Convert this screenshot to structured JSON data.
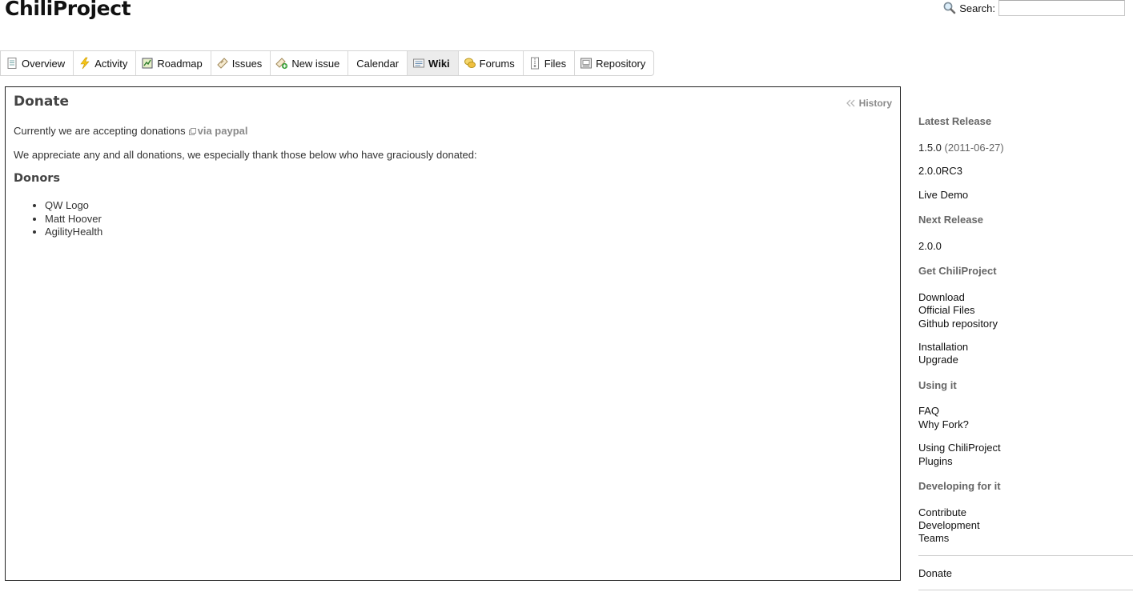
{
  "header": {
    "logo": "ChiliProject",
    "search_label": "Search:",
    "search_value": ""
  },
  "tabs": [
    {
      "label": "Overview",
      "icon": "page-icon"
    },
    {
      "label": "Activity",
      "icon": "lightning-icon"
    },
    {
      "label": "Roadmap",
      "icon": "roadmap-icon"
    },
    {
      "label": "Issues",
      "icon": "ticket-icon"
    },
    {
      "label": "New issue",
      "icon": "new-ticket-icon"
    },
    {
      "label": "Calendar",
      "icon": ""
    },
    {
      "label": "Wiki",
      "icon": "wiki-icon",
      "selected": true
    },
    {
      "label": "Forums",
      "icon": "forums-icon"
    },
    {
      "label": "Files",
      "icon": "files-icon"
    },
    {
      "label": "Repository",
      "icon": "repository-icon"
    }
  ],
  "content": {
    "title": "Donate",
    "history_label": "History",
    "para1_text": "Currently we are accepting donations",
    "paypal_link": "via paypal",
    "para2": "We appreciate any and all donations, we especially thank those below who have graciously donated:",
    "donors_heading": "Donors",
    "donors": [
      "QW Logo",
      "Matt Hoover",
      "AgilityHealth"
    ]
  },
  "sidebar": {
    "latest_heading": "Latest Release",
    "latest_version": "1.5.0",
    "latest_date": "(2011-06-27)",
    "rc_version": "2.0.0RC3",
    "live_demo": "Live Demo",
    "next_heading": "Next Release",
    "next_version": "2.0.0",
    "get_heading": "Get ChiliProject",
    "download": "Download",
    "official_files": "Official Files",
    "github_repository": "Github repository",
    "installation": "Installation",
    "upgrade": "Upgrade",
    "using_heading": "Using it",
    "faq": "FAQ",
    "why_fork": "Why Fork?",
    "using_chiliproject": "Using ChiliProject",
    "plugins": "Plugins",
    "developing_heading": "Developing for it",
    "contribute": "Contribute",
    "development": "Development",
    "teams": "Teams",
    "donate": "Donate"
  },
  "colors": {
    "link_gray": "#8a8a8a",
    "heading_gray": "#666666",
    "selected_tab_bg": "#ececec",
    "border_dark": "#222222"
  }
}
